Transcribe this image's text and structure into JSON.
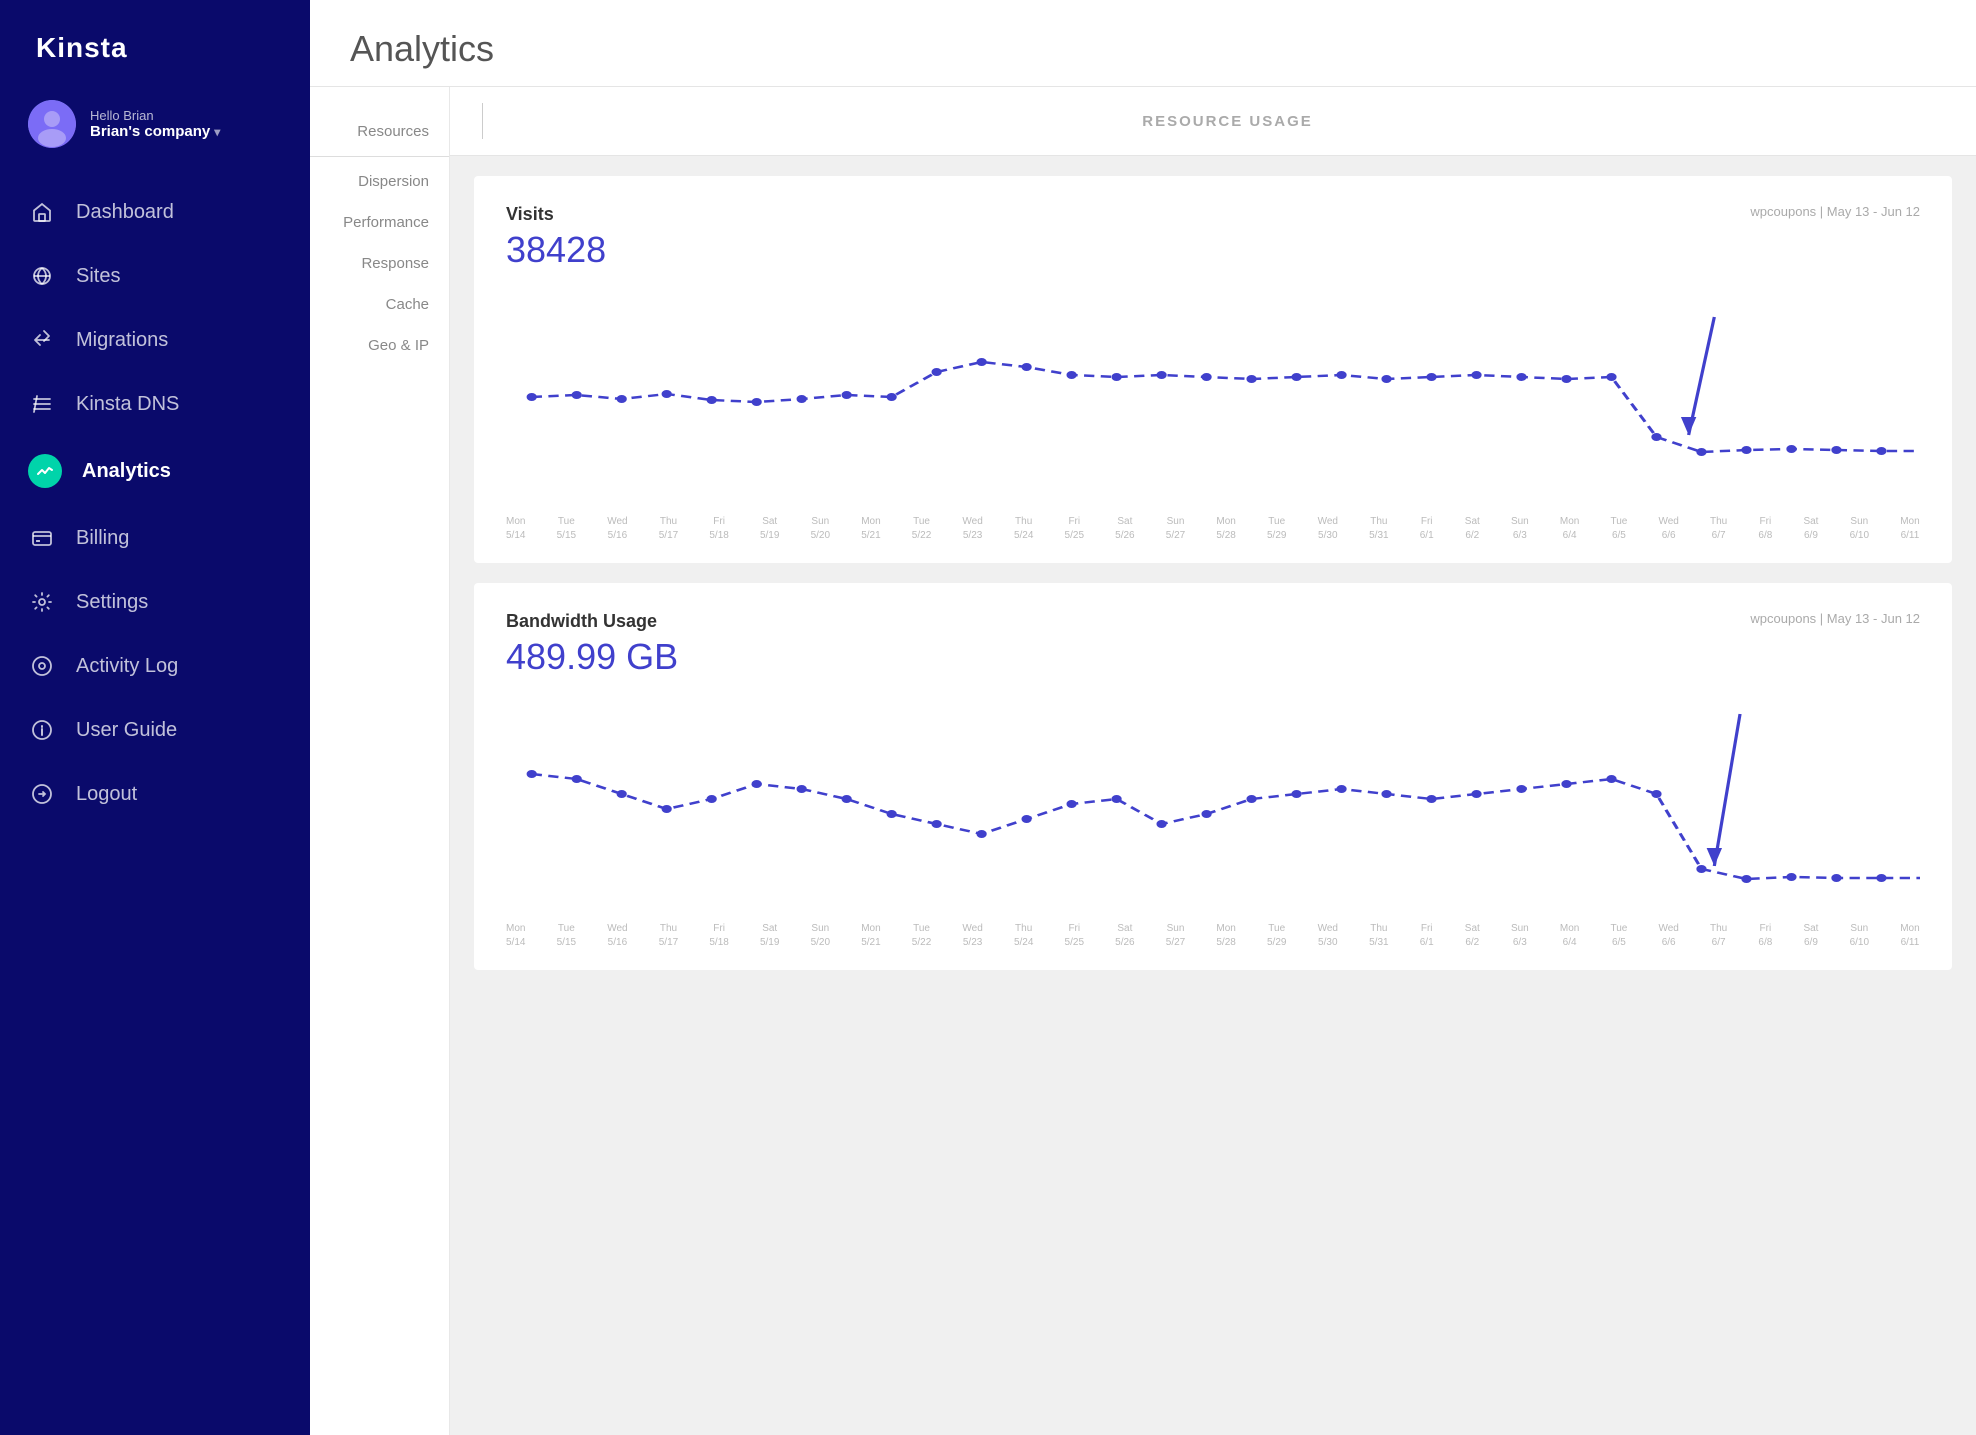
{
  "app": {
    "name": "Kinsta"
  },
  "sidebar": {
    "user": {
      "hello": "Hello Brian",
      "company": "Brian's company"
    },
    "nav_items": [
      {
        "id": "dashboard",
        "label": "Dashboard",
        "icon": "home"
      },
      {
        "id": "sites",
        "label": "Sites",
        "icon": "sites"
      },
      {
        "id": "migrations",
        "label": "Migrations",
        "icon": "migrations"
      },
      {
        "id": "kinsta-dns",
        "label": "Kinsta DNS",
        "icon": "dns"
      },
      {
        "id": "analytics",
        "label": "Analytics",
        "icon": "analytics",
        "active": true
      },
      {
        "id": "billing",
        "label": "Billing",
        "icon": "billing"
      },
      {
        "id": "settings",
        "label": "Settings",
        "icon": "settings"
      },
      {
        "id": "activity-log",
        "label": "Activity Log",
        "icon": "activity"
      },
      {
        "id": "user-guide",
        "label": "User Guide",
        "icon": "guide"
      },
      {
        "id": "logout",
        "label": "Logout",
        "icon": "logout"
      }
    ]
  },
  "page": {
    "title": "Analytics"
  },
  "sub_nav": {
    "items": [
      {
        "id": "resources",
        "label": "Resources"
      },
      {
        "id": "dispersion",
        "label": "Dispersion"
      },
      {
        "id": "performance",
        "label": "Performance"
      },
      {
        "id": "response",
        "label": "Response"
      },
      {
        "id": "cache",
        "label": "Cache"
      },
      {
        "id": "geo-ip",
        "label": "Geo & IP"
      }
    ]
  },
  "resource_usage": {
    "title": "RESOURCE USAGE"
  },
  "charts": [
    {
      "id": "visits",
      "label": "Visits",
      "value": "38428",
      "meta": "wpcoupons | May 13 - Jun 12",
      "color": "#4040cc",
      "dates": [
        "Mon 5/14",
        "Tue 5/15",
        "Wed 5/16",
        "Thu 5/17",
        "Fri 5/18",
        "Sat 5/19",
        "Sun 5/20",
        "Mon 5/21",
        "Tue 5/22",
        "Wed 5/23",
        "Thu 5/24",
        "Fri 5/25",
        "Sat 5/26",
        "Sun 5/27",
        "Mon 5/28",
        "Tue 5/29",
        "Wed 5/30",
        "Thu 5/31",
        "Fri 6/1",
        "Sat 6/2",
        "Sun 6/3",
        "Mon 6/4",
        "Tue 6/5",
        "Wed 6/6",
        "Thu 6/7",
        "Fri 6/8",
        "Sat 6/9",
        "Sun 6/10",
        "Mon 6/11"
      ]
    },
    {
      "id": "bandwidth",
      "label": "Bandwidth Usage",
      "value": "489.99 GB",
      "meta": "wpcoupons | May 13 - Jun 12",
      "color": "#4040cc",
      "dates": [
        "Mon 5/14",
        "Tue 5/15",
        "Wed 5/16",
        "Thu 5/17",
        "Fri 5/18",
        "Sat 5/19",
        "Sun 5/20",
        "Mon 5/21",
        "Tue 5/22",
        "Wed 5/23",
        "Thu 5/24",
        "Fri 5/25",
        "Sat 5/26",
        "Sun 5/27",
        "Mon 5/28",
        "Tue 5/29",
        "Wed 5/30",
        "Thu 5/31",
        "Fri 6/1",
        "Sat 6/2",
        "Sun 6/3",
        "Mon 6/4",
        "Tue 6/5",
        "Wed 6/6",
        "Thu 6/7",
        "Fri 6/8",
        "Sat 6/9",
        "Sun 6/10",
        "Mon 6/11"
      ]
    }
  ]
}
